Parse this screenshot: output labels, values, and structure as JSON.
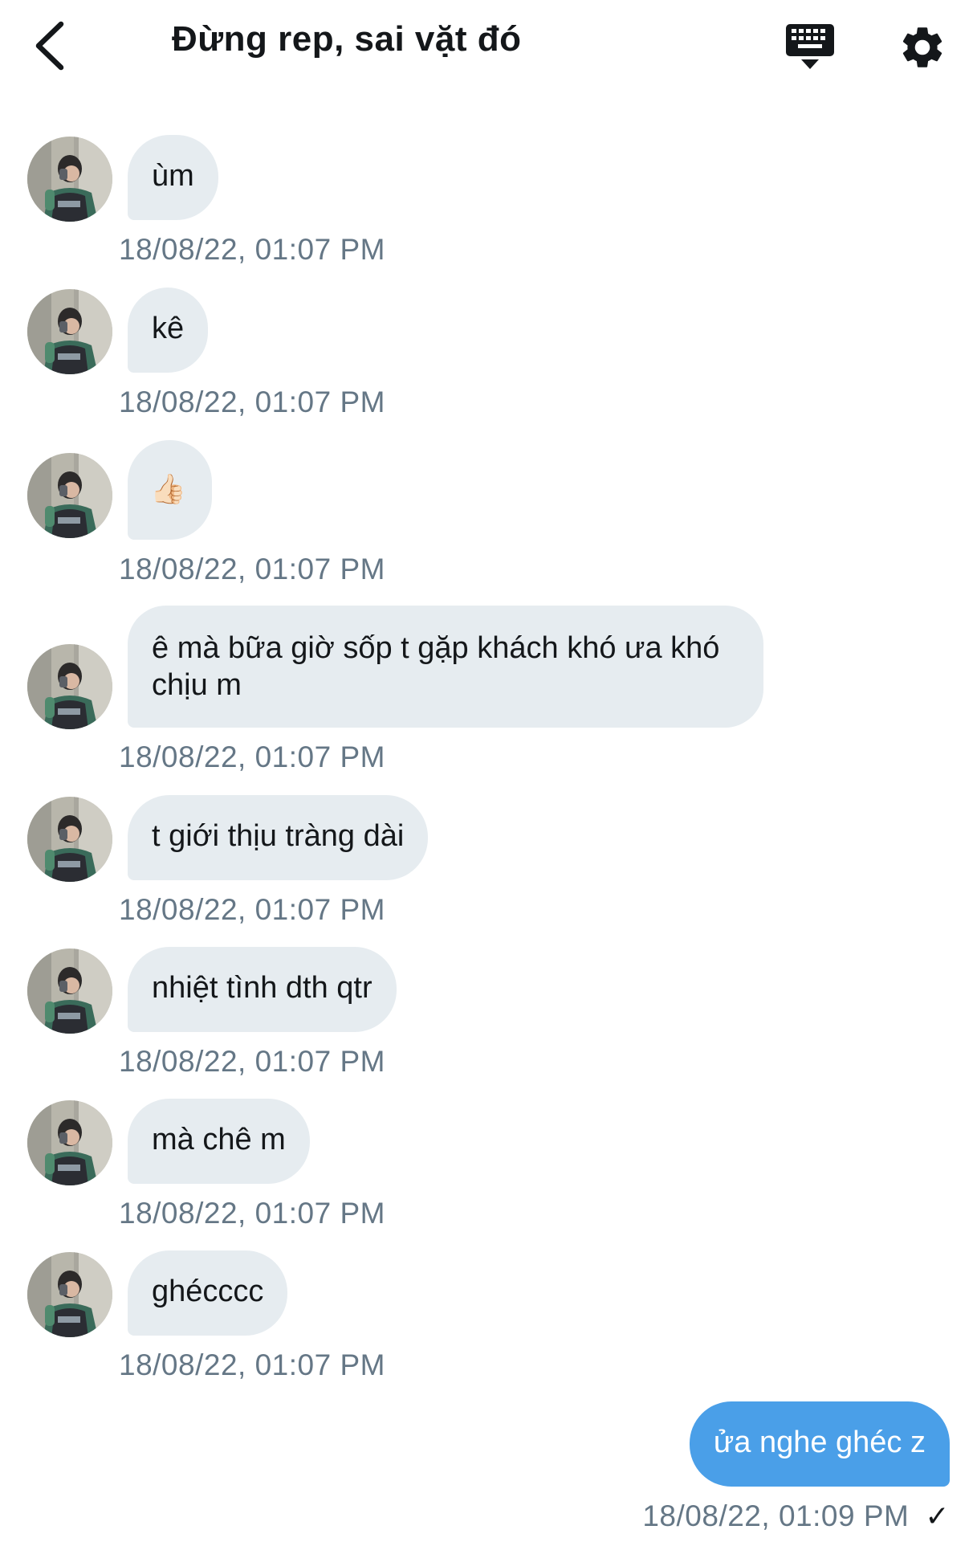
{
  "header": {
    "title": "Đừng rep, sai vặt đó",
    "back_icon": "chevron-left-icon",
    "keyboard_icon": "keyboard-icon",
    "settings_icon": "gear-icon"
  },
  "messages": [
    {
      "text": "ùm",
      "time": "18/08/22, 01:07 PM"
    },
    {
      "text": "kê",
      "time": "18/08/22, 01:07 PM"
    },
    {
      "text": "👍🏻",
      "time": "18/08/22, 01:07 PM"
    },
    {
      "text": "ê mà bữa giờ sốp t gặp khách khó ưa khó chịu m",
      "time": "18/08/22, 01:07 PM"
    },
    {
      "text": "t giới thịu tràng dài",
      "time": "18/08/22, 01:07 PM"
    },
    {
      "text": "nhiệt tình dth qtr",
      "time": "18/08/22, 01:07 PM"
    },
    {
      "text": "mà chê m",
      "time": "18/08/22, 01:07 PM"
    },
    {
      "text": "ghécccc",
      "time": "18/08/22, 01:07 PM"
    }
  ],
  "outgoing": {
    "text": "ửa nghe ghéc z",
    "time": "18/08/22, 01:09 PM",
    "status": "✓"
  },
  "colors": {
    "incoming_bubble": "#e6ecf0",
    "outgoing_bubble": "#4a9fe8",
    "timestamp": "#657786"
  }
}
